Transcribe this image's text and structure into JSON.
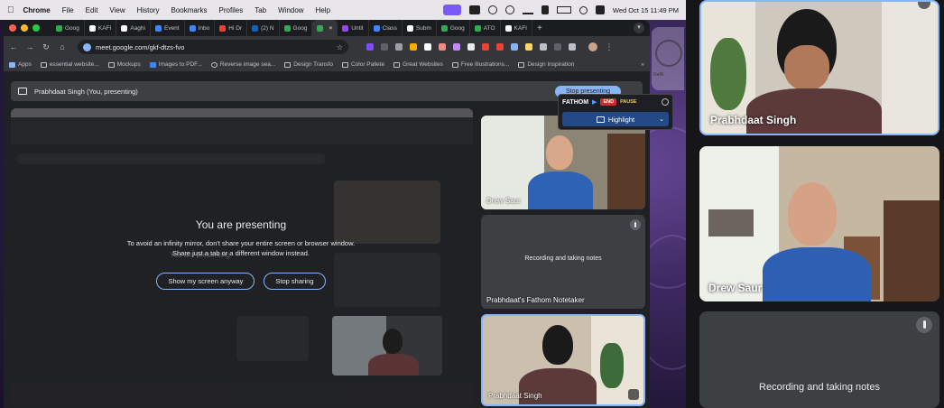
{
  "menubar": {
    "app": "Chrome",
    "items": [
      "File",
      "Edit",
      "View",
      "History",
      "Bookmarks",
      "Profiles",
      "Tab",
      "Window",
      "Help"
    ],
    "clock": "Wed Oct 15  11:49 PM"
  },
  "tabs": [
    {
      "label": "Goog",
      "color": "#34a853"
    },
    {
      "label": "KAFI",
      "color": "#ffffff"
    },
    {
      "label": "Aaghi",
      "color": "#ffffff"
    },
    {
      "label": "Event",
      "color": "#4285f4"
    },
    {
      "label": "Inbo",
      "color": "#4285f4"
    },
    {
      "label": "Hi Dr",
      "color": "#ea4335"
    },
    {
      "label": "(2) N",
      "color": "#0a66c2"
    },
    {
      "label": "Goog",
      "color": "#34a853"
    },
    {
      "label": "",
      "color": "#34a853",
      "active": true
    },
    {
      "label": "Untit",
      "color": "#a142f4"
    },
    {
      "label": "Class",
      "color": "#4285f4"
    },
    {
      "label": "Subm",
      "color": "#ffffff"
    },
    {
      "label": "Goog",
      "color": "#34a853"
    },
    {
      "label": "ATO",
      "color": "#34a853"
    },
    {
      "label": "KAFI",
      "color": "#ffffff"
    }
  ],
  "omnibox": {
    "url": "meet.google.com/gkf-dtzs-fvo"
  },
  "bookmarks": [
    "Apps",
    "essential website...",
    "Mockups",
    "Images to PDF...",
    "Reverse image sea...",
    "Design Transfo",
    "Color Pallete",
    "Great Websites",
    "Free Illustrations...",
    "Design Inspiration"
  ],
  "meet": {
    "presenter_bar": "Prabhdaat Singh (You, presenting)",
    "stop_presenting": "Stop presenting",
    "present_title": "You are presenting",
    "present_line1": "To avoid an infinity mirror, don't share your entire screen or browser window.",
    "present_line2": "Share just a tab or a different window instead.",
    "show_anyway": "Show my screen anyway",
    "stop_sharing": "Stop sharing",
    "mirror_title": "You are presenting"
  },
  "fathom": {
    "brand": "FATHOM",
    "end": "END",
    "pause": "PAUSE",
    "highlight": "Highlight"
  },
  "side_tiles": {
    "drew": "Drew Saur",
    "notetaker": "Prabhdaat's Fathom Notetaker",
    "notes_text": "Recording and taking notes",
    "prabhdaat": "Prabhdaat Singh"
  },
  "gallery": {
    "tile1": "Prabhdaat Singh",
    "tile2": "Drew Saur",
    "tile3_notes": "Recording and taking notes"
  },
  "widget": {
    "label": "DeIN"
  },
  "colors": {
    "accent": "#8ab4f8",
    "meet_bg": "#202124",
    "tile_bg": "#3c4043",
    "fathom_end": "#c53030"
  }
}
